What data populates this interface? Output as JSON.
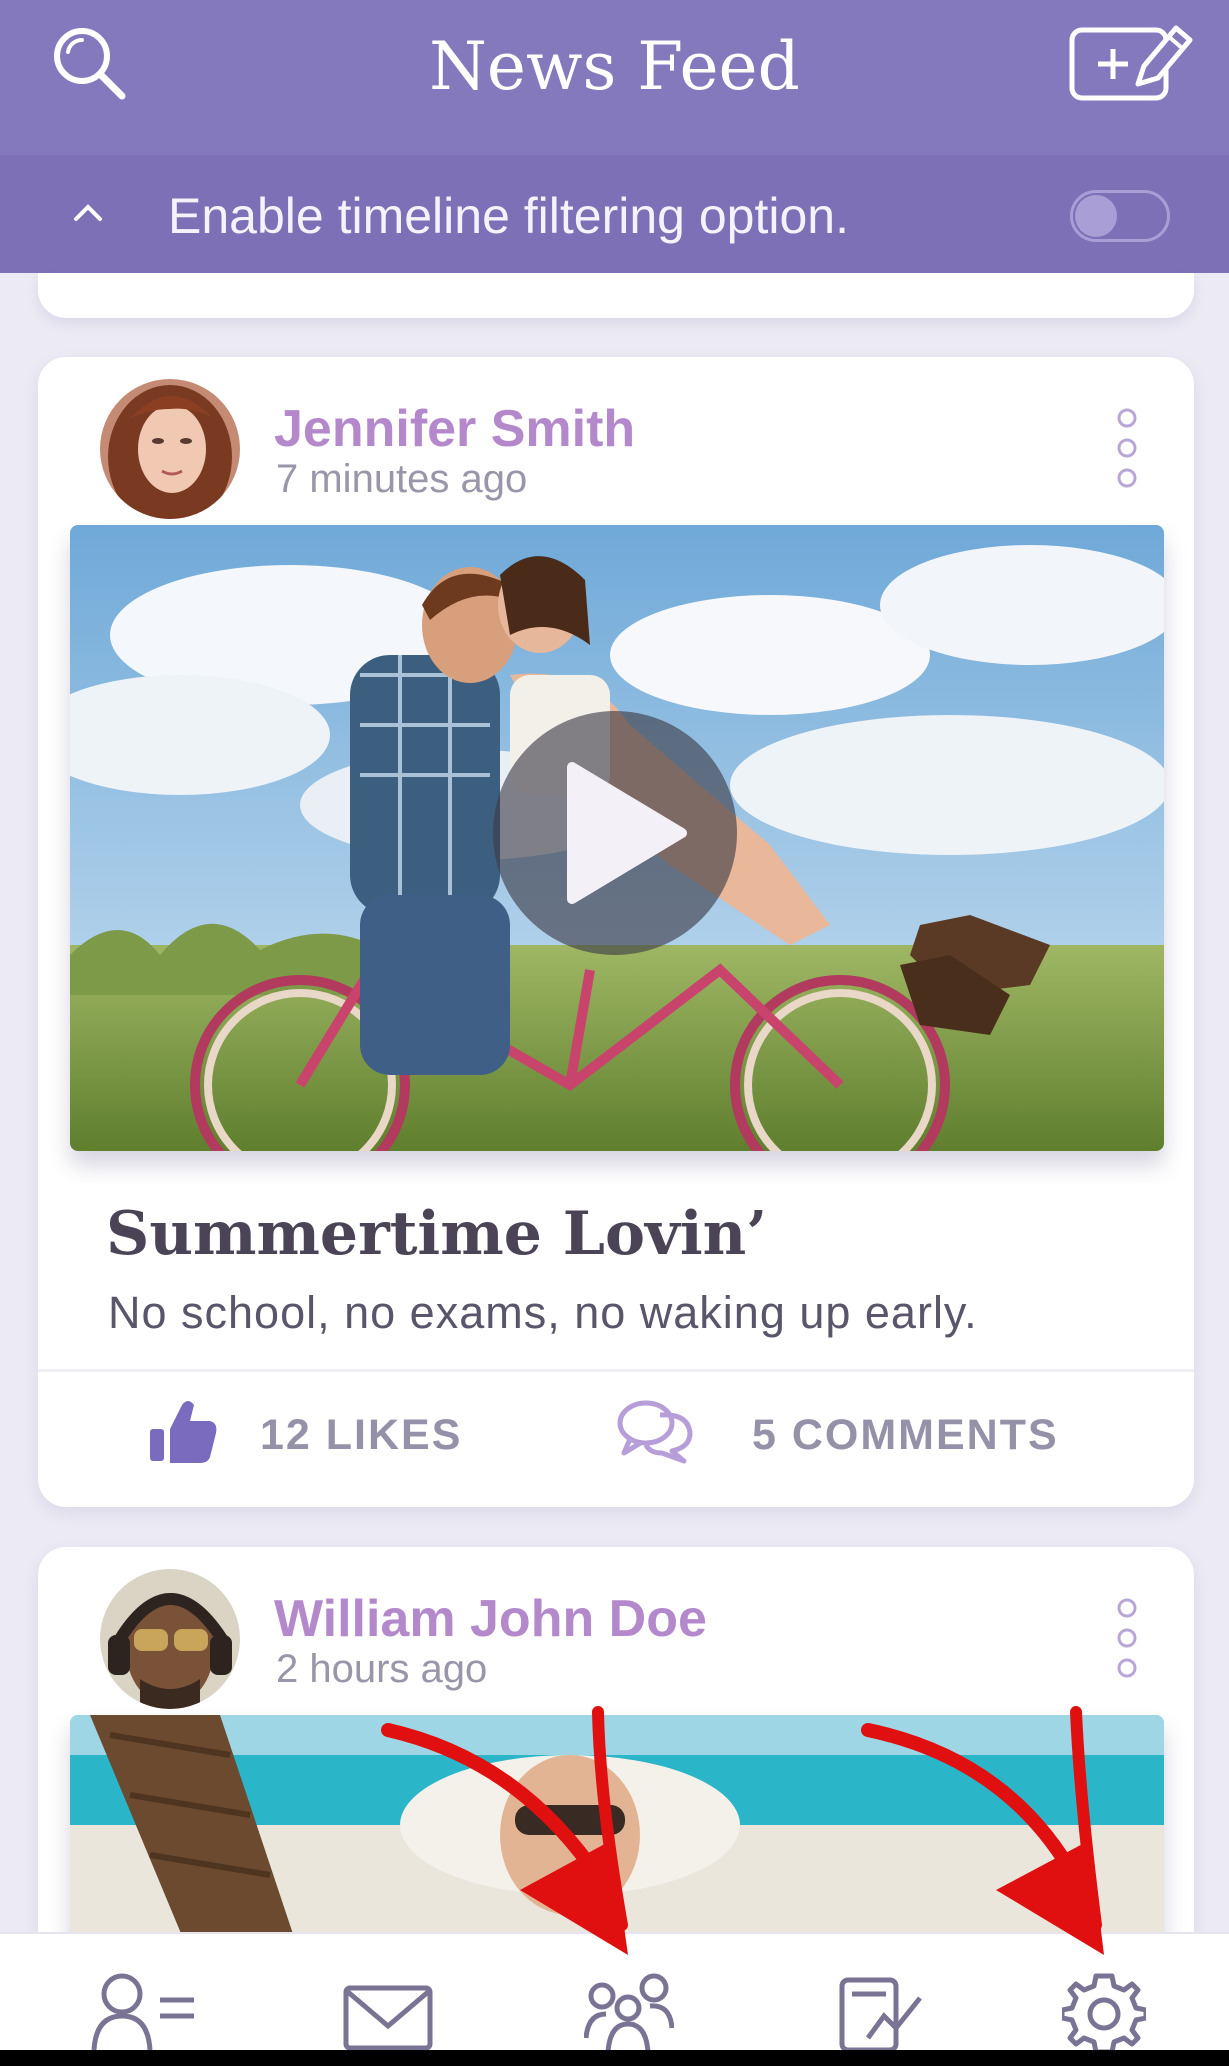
{
  "header": {
    "title": "News Feed",
    "search_icon": "search-icon",
    "compose_icon": "compose-icon"
  },
  "filter_bar": {
    "text": "Enable timeline filtering option.",
    "toggle_on": false
  },
  "posts": [
    {
      "author": "Jennifer Smith",
      "time": "7 minutes ago",
      "title": "Summertime Lovin’",
      "body": "No school, no exams, no waking up early.",
      "likes_label": "12 LIKES",
      "comments_label": "5 COMMENTS",
      "media": "video"
    },
    {
      "author": "William John Doe",
      "time": "2 hours ago",
      "media": "photo"
    }
  ],
  "tabbar": {
    "items": [
      "profile-icon",
      "mail-icon",
      "friends-icon",
      "activity-icon",
      "settings-icon"
    ]
  },
  "colors": {
    "header": "#8479bd",
    "filter_bar": "#7e70b7",
    "author": "#b389cb",
    "like_icon": "#7b6bbf",
    "annotation_arrow": "#e01010"
  }
}
